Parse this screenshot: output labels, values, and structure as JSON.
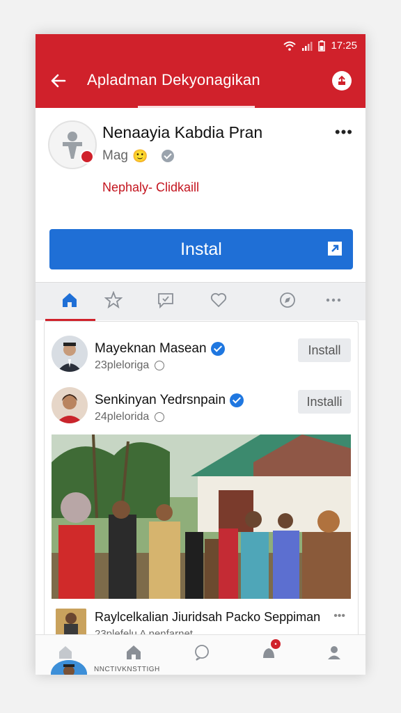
{
  "status_bar": {
    "time": "17:25"
  },
  "header": {
    "title": "Apladman Dekyonagikan"
  },
  "app": {
    "name": "Nenaayia Kabdia Pran",
    "subtitle": "Mag",
    "subtitle_emoji": "🙂",
    "developer": "Nephaly- Clidkaill",
    "install_label": "Instal"
  },
  "tabs": [
    "home-icon",
    "star-icon",
    "chat-icon",
    "heart-icon",
    "compass-icon",
    "more-icon"
  ],
  "feed": {
    "items": [
      {
        "name": "Mayeknan Masean",
        "meta": "23pleloriga",
        "install_label": "Install"
      },
      {
        "name": "Senkinyan Yedrsnpain",
        "meta": "24plelorida",
        "install_label": "Installi"
      }
    ],
    "post": {
      "title": "Raylcelkalian Jiuridsah Packo Seppiman",
      "meta": "23plefelu A nenfarnet"
    }
  },
  "bottom_nav": {
    "items": [
      "home-icon",
      "home-icon",
      "chat-icon",
      "notification-icon",
      "profile-icon"
    ],
    "caption": "NNCTIVKNSTTIGH"
  },
  "colors": {
    "brand": "#d0212b",
    "primary": "#1f6fd6"
  }
}
